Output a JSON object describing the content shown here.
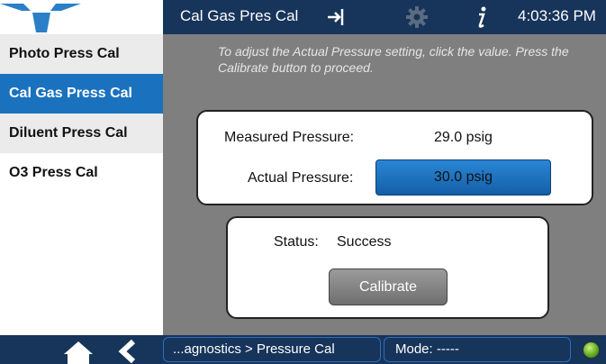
{
  "header": {
    "title": "Cal Gas Pres Cal",
    "time": "4:03:36 PM",
    "icons": [
      "logo-icon",
      "exit-icon",
      "gear-icon",
      "info-icon"
    ]
  },
  "sidebar": {
    "items": [
      {
        "label": "Photo Press Cal",
        "active": false
      },
      {
        "label": "Cal Gas Press Cal",
        "active": true
      },
      {
        "label": "Diluent Press Cal",
        "active": false
      },
      {
        "label": "O3 Press Cal",
        "active": false
      }
    ]
  },
  "main": {
    "instructions": "To adjust the Actual Pressure setting, click the value. Press the Calibrate button to proceed.",
    "measured_label": "Measured Pressure:",
    "measured_value": "29.0 psig",
    "actual_label": "Actual Pressure:",
    "actual_value": "30.0 psig",
    "status_label": "Status:",
    "status_value": "Success",
    "calibrate_label": "Calibrate"
  },
  "footer": {
    "breadcrumb": "...agnostics > Pressure Cal",
    "mode": "Mode: -----",
    "icons": [
      "home-icon",
      "back-icon",
      "status-led-icon"
    ]
  },
  "colors": {
    "bar": "#17345a",
    "accent": "#1a72bf",
    "background": "#7f7f7f"
  }
}
